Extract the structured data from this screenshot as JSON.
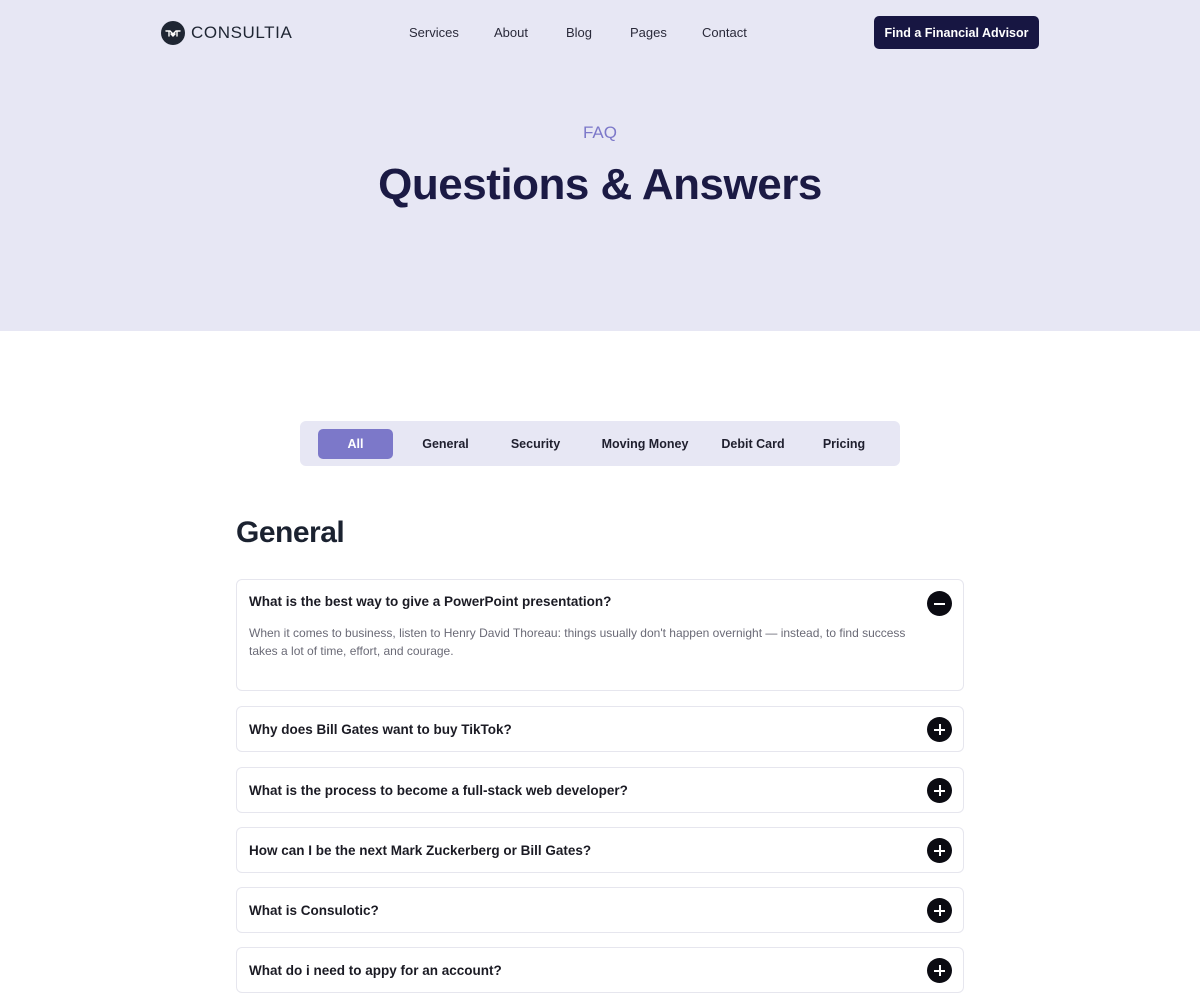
{
  "brand": {
    "name": "CONSULTIA",
    "logo_icon": "handshake-icon"
  },
  "nav": [
    "Services",
    "About",
    "Blog",
    "Pages",
    "Contact"
  ],
  "cta_label": "Find a Financial Advisor",
  "hero": {
    "eyebrow": "FAQ",
    "title": "Questions & Answers"
  },
  "filters": {
    "active": "All",
    "items": [
      "All",
      "General",
      "Security",
      "Moving Money",
      "Debit Card",
      "Pricing"
    ]
  },
  "section_title": "General",
  "faqs": [
    {
      "question": "What is the best way to give a PowerPoint presentation?",
      "answer": "When it comes to business, listen to Henry David Thoreau: things usually don't happen overnight — instead, to find success takes a lot of time, effort, and courage.",
      "expanded": true,
      "icon": "minus-circle-icon"
    },
    {
      "question": "Why does Bill Gates want to buy TikTok?",
      "expanded": false,
      "icon": "plus-circle-icon"
    },
    {
      "question": "What is the process to become a full-stack web developer?",
      "expanded": false,
      "icon": "plus-circle-icon"
    },
    {
      "question": "How can I be the next Mark Zuckerberg or Bill Gates?",
      "expanded": false,
      "icon": "plus-circle-icon"
    },
    {
      "question": "What is Consulotic?",
      "expanded": false,
      "icon": "plus-circle-icon"
    },
    {
      "question": "What do i need to appy for an account?",
      "expanded": false,
      "icon": "plus-circle-icon"
    }
  ],
  "colors": {
    "accent": "#7c78c9",
    "navy": "#171642",
    "hero_bg": "#e7e7f4",
    "toggle": "#0b0b12"
  }
}
